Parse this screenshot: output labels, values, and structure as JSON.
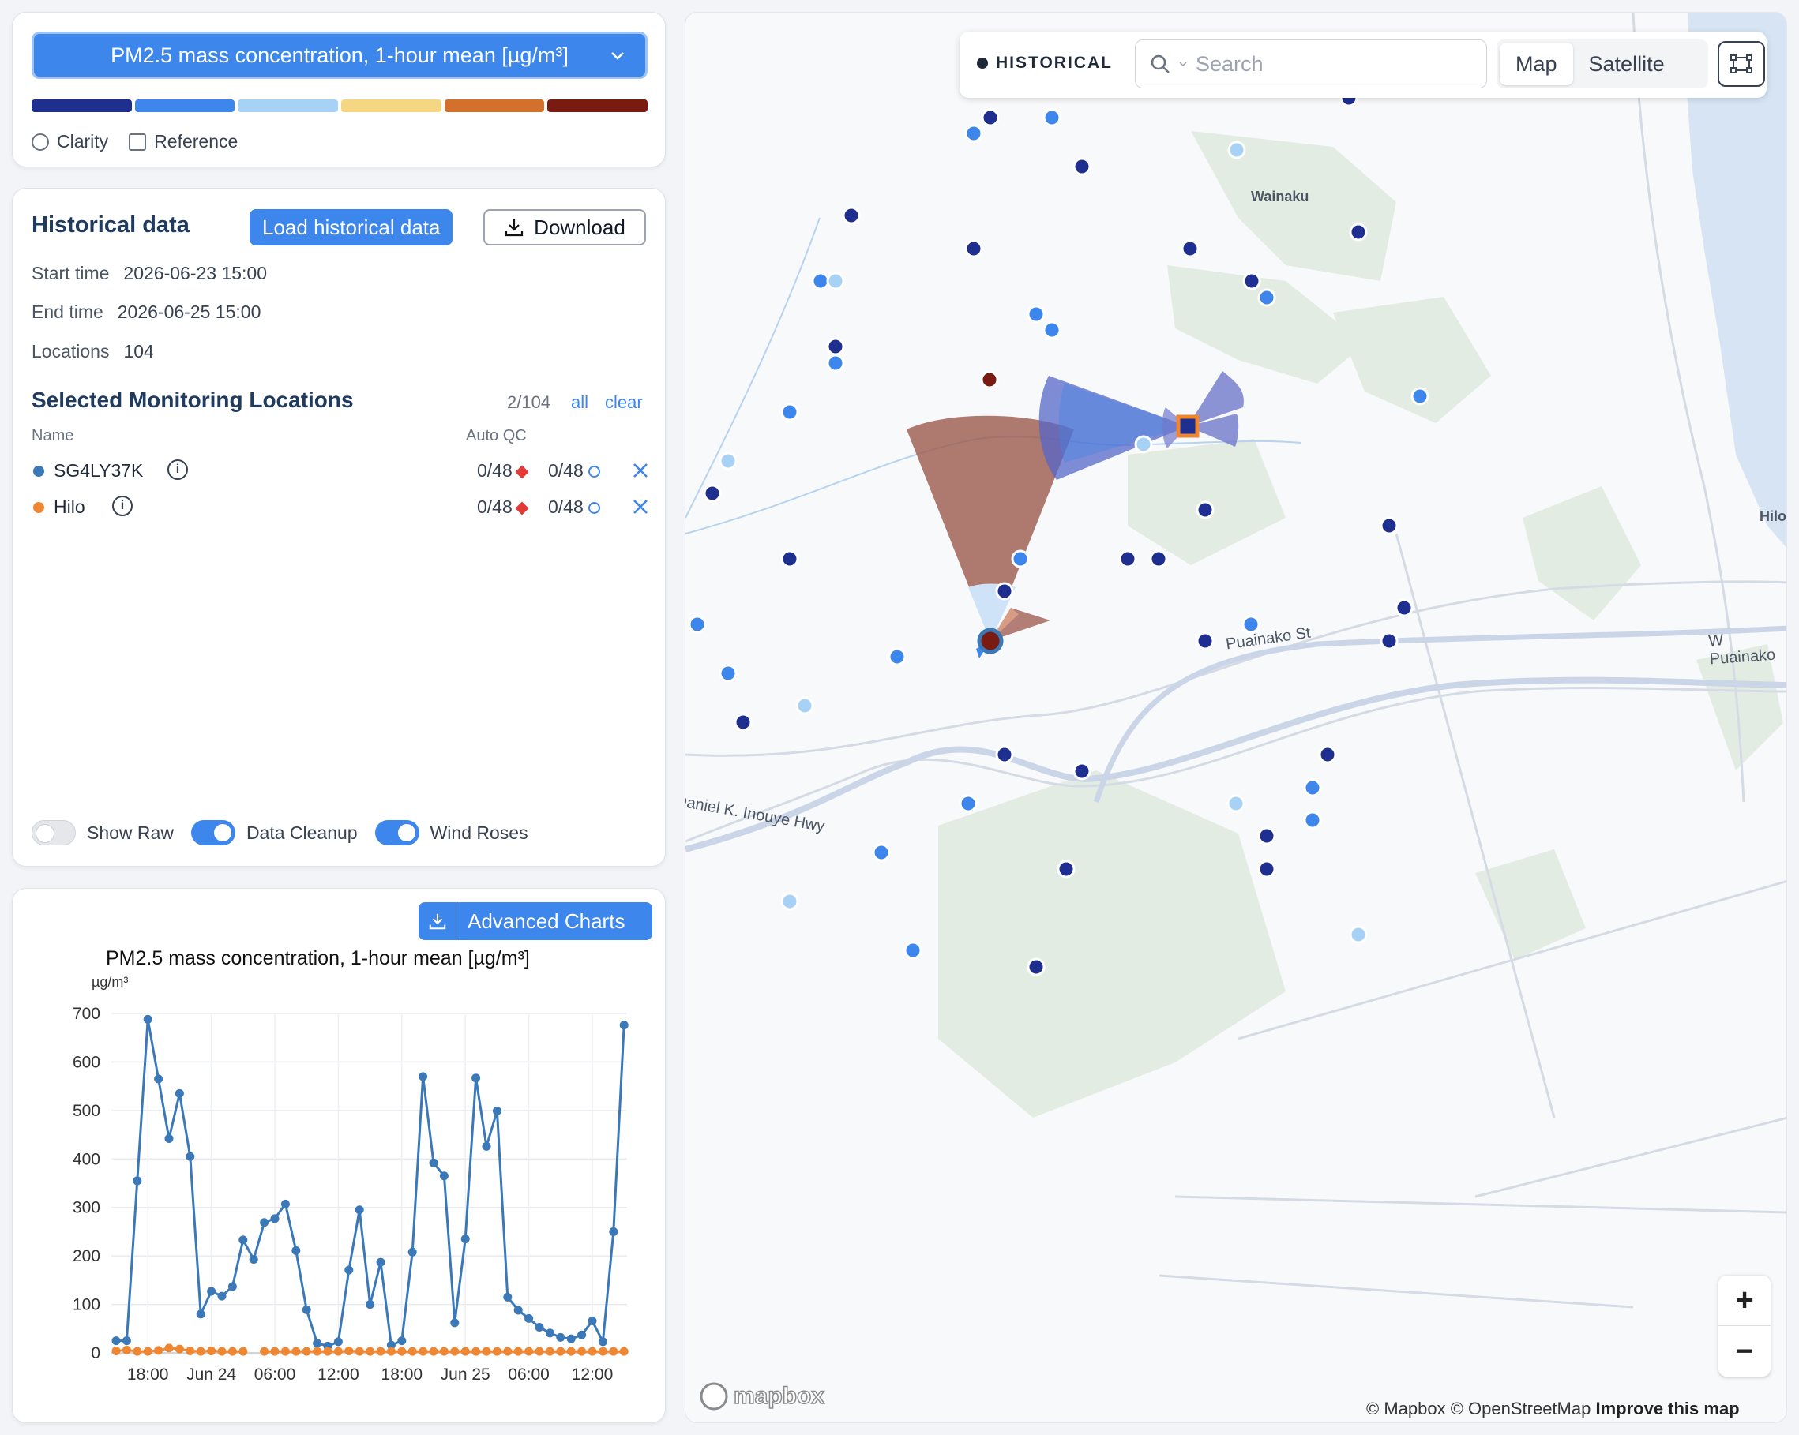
{
  "selector": {
    "parameter": "PM2.5 mass concentration, 1-hour mean [µg/m³]",
    "scale_colors": [
      "#1f2f8f",
      "#3d86ec",
      "#a8d2f5",
      "#f5d782",
      "#d2702c",
      "#7a1b12"
    ],
    "clarity_label": "Clarity",
    "reference_label": "Reference"
  },
  "history": {
    "title": "Historical data",
    "load_label": "Load historical data",
    "download_label": "Download",
    "start_label": "Start time",
    "start_value": "2026-06-23 15:00",
    "end_label": "End time",
    "end_value": "2026-06-25 15:00",
    "locations_label": "Locations",
    "locations_value": "104",
    "selected_title": "Selected Monitoring Locations",
    "selected_count": "2/104",
    "all_label": "all",
    "clear_label": "clear",
    "col_name": "Name",
    "col_qc": "Auto QC",
    "locations": [
      {
        "name": "SG4LY37K",
        "color": "#3a78b8",
        "qc1": "0/48",
        "qc2": "0/48"
      },
      {
        "name": "Hilo",
        "color": "#ee8632",
        "qc1": "0/48",
        "qc2": "0/48"
      }
    ],
    "toggles": [
      {
        "label": "Show Raw",
        "on": false
      },
      {
        "label": "Data Cleanup",
        "on": true
      },
      {
        "label": "Wind Roses",
        "on": true
      }
    ]
  },
  "chart_panel": {
    "advanced_label": "Advanced Charts"
  },
  "chart_data": {
    "type": "line",
    "title": "PM2.5 mass concentration, 1-hour mean [µg/m³]",
    "ylabel": "µg/m³",
    "ylim": [
      0,
      700
    ],
    "yticks": [
      0,
      100,
      200,
      300,
      400,
      500,
      600,
      700
    ],
    "x_tick_labels": [
      "18:00",
      "Jun 24",
      "06:00",
      "12:00",
      "18:00",
      "Jun 25",
      "06:00",
      "12:00"
    ],
    "x_tick_hours": [
      3,
      9,
      15,
      21,
      27,
      33,
      39,
      45
    ],
    "x_hours": [
      0,
      1,
      2,
      3,
      4,
      5,
      6,
      7,
      8,
      9,
      10,
      11,
      12,
      13,
      14,
      15,
      16,
      17,
      18,
      19,
      20,
      21,
      22,
      23,
      24,
      25,
      26,
      27,
      28,
      29,
      30,
      31,
      32,
      33,
      34,
      35,
      36,
      37,
      38,
      39,
      40,
      41,
      42,
      43,
      44,
      45,
      46,
      47,
      48
    ],
    "series": [
      {
        "name": "SG4LY37K",
        "color": "#3a78b8",
        "values": [
          25,
          25,
          355,
          688,
          565,
          442,
          535,
          405,
          80,
          127,
          117,
          137,
          233,
          193,
          269,
          277,
          307,
          211,
          89,
          20,
          14,
          23,
          171,
          295,
          100,
          187,
          16,
          25,
          208,
          570,
          392,
          365,
          62,
          235,
          567,
          426,
          499,
          115,
          88,
          71,
          53,
          41,
          32,
          29,
          37,
          66,
          23,
          250,
          676
        ]
      },
      {
        "name": "Hilo",
        "color": "#ee8632",
        "values": [
          4,
          6,
          3,
          3,
          5,
          10,
          8,
          4,
          3,
          4,
          3,
          3,
          3,
          null,
          3,
          3,
          3,
          3,
          3,
          3,
          3,
          3,
          4,
          3,
          3,
          3,
          3,
          3,
          3,
          3,
          3,
          3,
          3,
          3,
          3,
          3,
          3,
          3,
          3,
          3,
          3,
          3,
          3,
          3,
          3,
          3,
          3,
          3,
          3
        ]
      }
    ]
  },
  "map": {
    "historical_label": "HISTORICAL",
    "search_placeholder": "Search",
    "map_label": "Map",
    "satellite_label": "Satellite",
    "places": [
      "Wainaku",
      "Hilo"
    ],
    "roads": [
      "Puainako St",
      "Daniel K. Inouye Hwy",
      "W Puainako"
    ],
    "zoom_in": "+",
    "zoom_out": "−",
    "logo": "mapbox",
    "attribution": "© Mapbox © OpenStreetMap",
    "improve": "Improve this map"
  }
}
